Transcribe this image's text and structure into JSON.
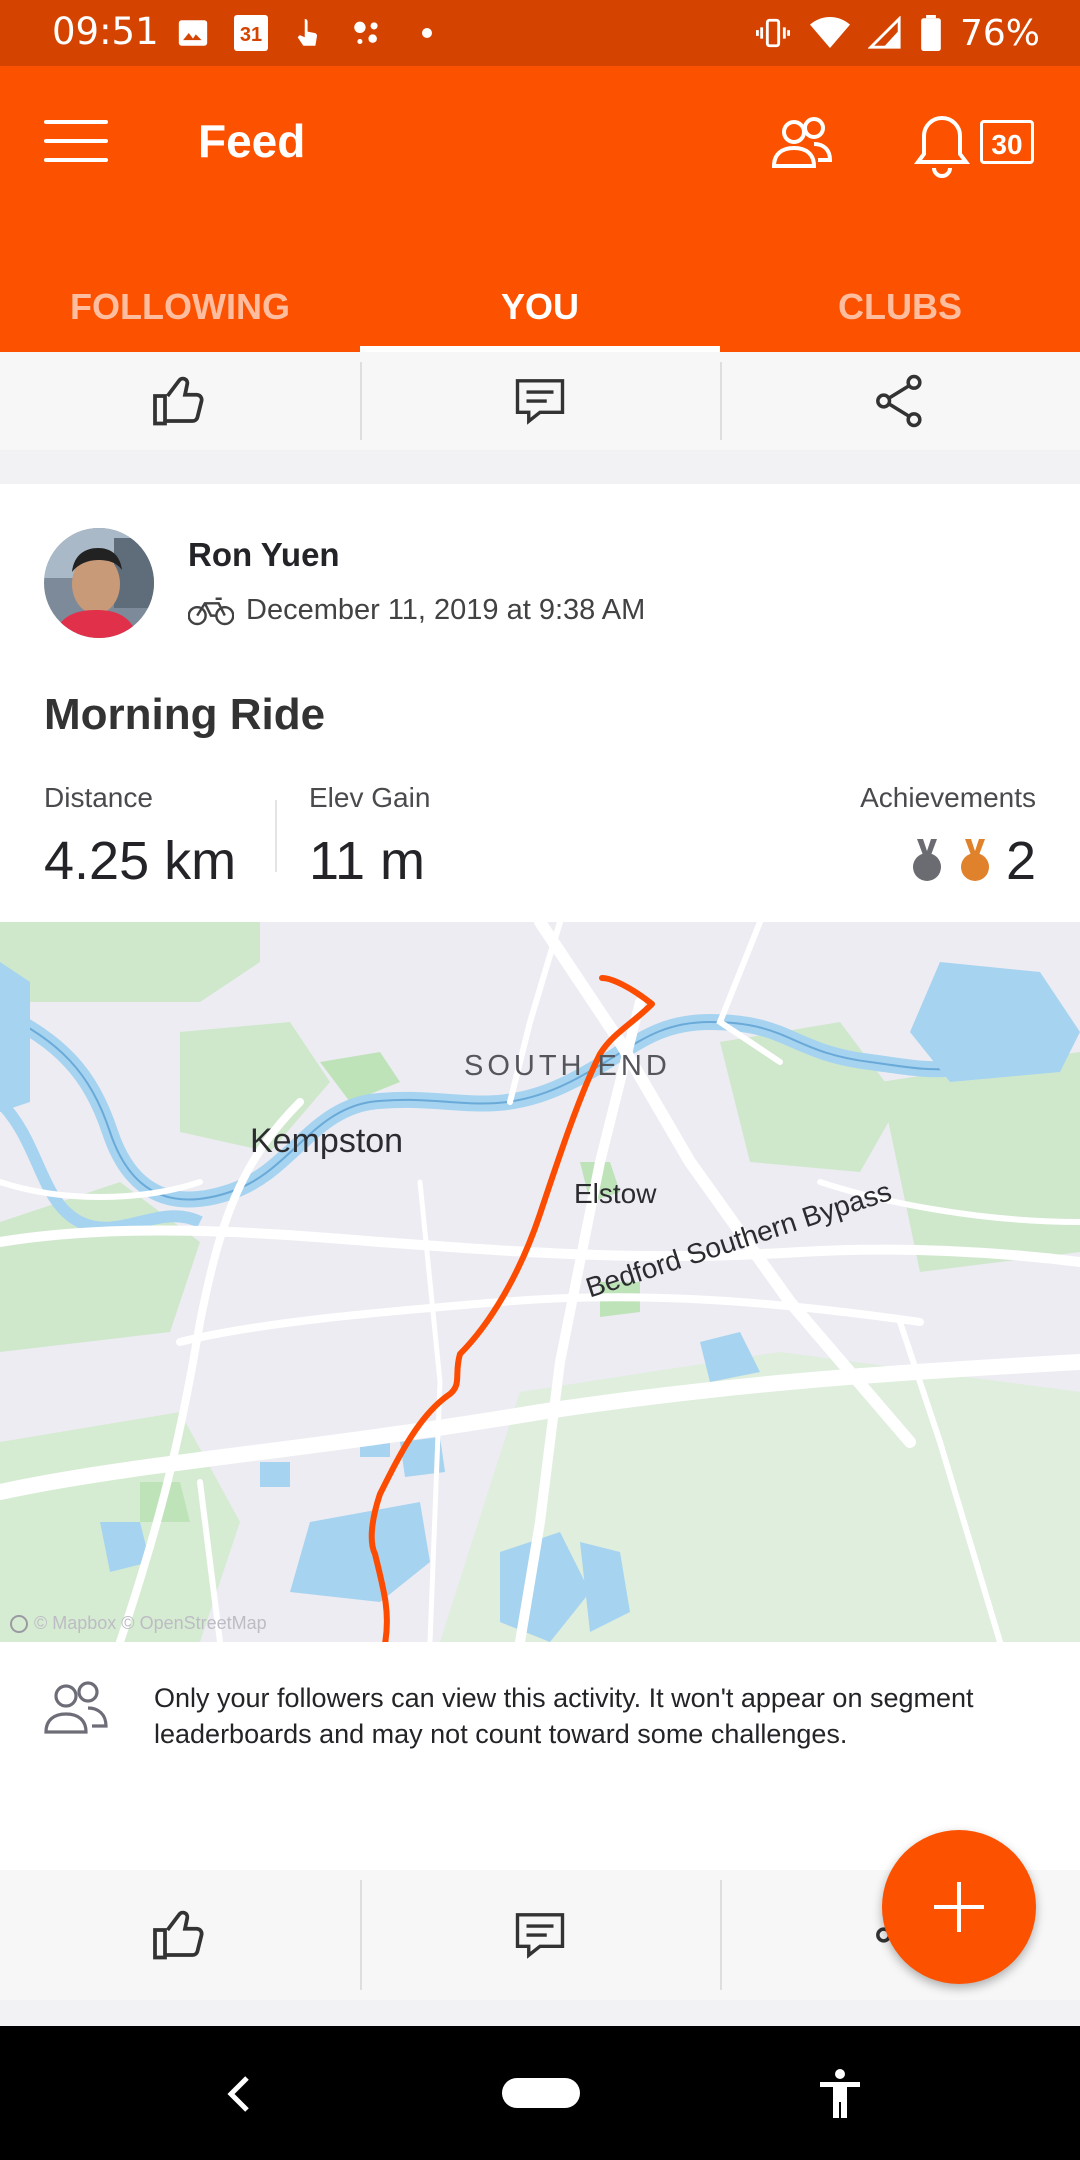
{
  "status_bar": {
    "time": "09:51",
    "calendar_day": "31",
    "battery": "76%"
  },
  "header": {
    "title": "Feed",
    "notification_count": "30"
  },
  "tabs": [
    {
      "label": "FOLLOWING",
      "active": false
    },
    {
      "label": "YOU",
      "active": true
    },
    {
      "label": "CLUBS",
      "active": false
    }
  ],
  "activity": {
    "athlete_name": "Ron Yuen",
    "datetime": "December 11, 2019 at 9:38 AM",
    "title": "Morning Ride",
    "stats": {
      "distance_label": "Distance",
      "distance_value": "4.25 km",
      "elev_label": "Elev Gain",
      "elev_value": "11 m",
      "achievements_label": "Achievements",
      "achievements_count": "2"
    },
    "map": {
      "labels": {
        "south_end": "SOUTH END",
        "kempston": "Kempston",
        "elstow": "Elstow",
        "bypass": "Bedford Southern Bypass"
      },
      "attribution": "© Mapbox © OpenStreetMap"
    },
    "privacy_note": "Only your followers can view this activity. It won't appear on segment leaderboards and may not count toward some challenges."
  },
  "colors": {
    "brand": "#fc5200",
    "status_bar": "#d44400",
    "route": "#fc4c02",
    "water": "#a6d3f0",
    "park": "#c8e6c0"
  }
}
